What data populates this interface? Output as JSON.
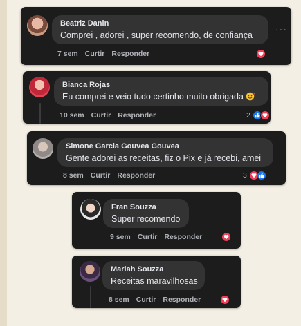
{
  "comments": [
    {
      "name": "Beatriz Danin",
      "text": "Comprei , adorei , super recomendo, de confiança",
      "time": "7 sem",
      "like_label": "Curtir",
      "reply_label": "Responder",
      "reaction_count": "",
      "reactions": [
        "heart"
      ]
    },
    {
      "name": "Bianca Rojas",
      "text": "Eu comprei e veio tudo certinho muito obrigada",
      "time": "10 sem",
      "like_label": "Curtir",
      "reply_label": "Responder",
      "reaction_count": "2",
      "reactions": [
        "like",
        "heart"
      ]
    },
    {
      "name": "Simone Garcia Gouvea Gouvea",
      "text": "Gente adorei as receitas, fiz o Pix e já recebi, amei",
      "time": "8 sem",
      "like_label": "Curtir",
      "reply_label": "Responder",
      "reaction_count": "3",
      "reactions": [
        "heart",
        "like"
      ]
    },
    {
      "name": "Fran Souzza",
      "text": "Super recomendo",
      "time": "9 sem",
      "like_label": "Curtir",
      "reply_label": "Responder",
      "reaction_count": "",
      "reactions": [
        "heart"
      ]
    },
    {
      "name": "Mariah Souzza",
      "text": "Receitas maravilhosas",
      "time": "8 sem",
      "like_label": "Curtir",
      "reply_label": "Responder",
      "reaction_count": "",
      "reactions": [
        "heart"
      ]
    }
  ],
  "more_options": "···",
  "colors": {
    "card_bg": "#1c1c1d",
    "bubble_bg": "#333334",
    "heart": "#f33e58",
    "like": "#1877f2",
    "page_bg": "#f4efe4"
  }
}
